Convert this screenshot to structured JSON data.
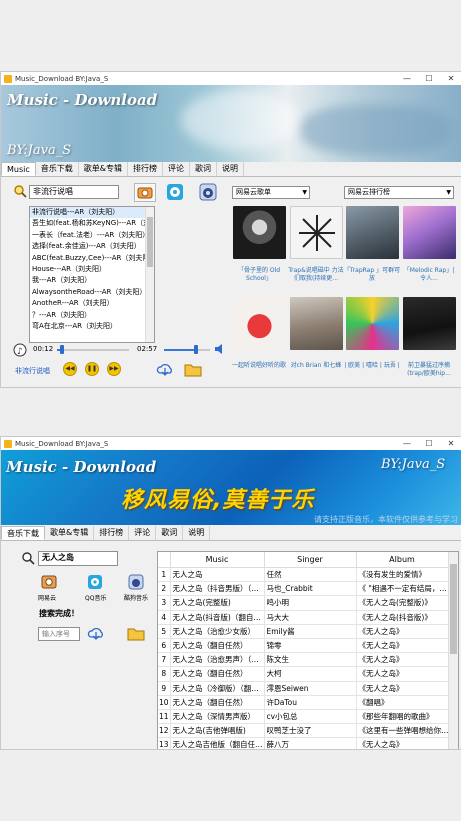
{
  "window1": {
    "title": "Music_Download  BY:Java_S",
    "banner": {
      "brand": "Music - Download",
      "byline": "BY:Java_S"
    },
    "tabs": [
      "Music",
      "音乐下载",
      "歌单&专辑",
      "排行榜",
      "评论",
      "歌词",
      "说明"
    ],
    "search_value": "非流行说唱",
    "song_list": [
      "非流行说唱---AR（刘夫阳）",
      "吾生如(feat.杨和苏KeyNG)---AR（刘",
      "一表长（feat.法老）---AR（刘夫阳）",
      "选择(feat.余佳运)---AR（刘夫阳）",
      "ABC(feat.Buzzy,Cee)---AR（刘夫阳",
      "House---AR（刘夫阳）",
      "我---AR（刘夫阳）",
      "AlwaysontheRoad---AR（刘夫阳）",
      "AnotheR---AR（刘夫阳）",
      "？---AR（刘夫阳）",
      "弯A在北京---AR（刘夫阳）"
    ],
    "time_elapsed": "00:12",
    "time_total": "02:57",
    "progress": 0.07,
    "volume": 0.7,
    "now_playing": "非流行说唱",
    "playlist_combo": "网易云歌单",
    "ranking_combo": "网易云排行榜",
    "covers_row1": [
      "「骨子里的 Old School」",
      "Trap&说唱磁中 力法们取我(持续更...",
      "「TrapRap 」可群可放",
      "「Melodic Rap」| 令人..."
    ],
    "covers_row2": [
      "一起听说唱好听的歌",
      "对ch Brian 和七蜂",
      "| 欧美 | 嘻哈 | 玩吾 |",
      "前卫暴猛过序摘(trap/欧美hip..."
    ]
  },
  "window2": {
    "title": "Music_Download  BY:Java_S",
    "banner": {
      "brand": "Music - Download",
      "byline": "BY:Java_S",
      "slogan": "移风易俗,莫善于乐",
      "notice": "请支持正版音乐，本软件仅供参考与学习"
    },
    "tabs": [
      "音乐下载",
      "歌单&专辑",
      "排行榜",
      "评论",
      "歌词",
      "说明"
    ],
    "search_value": "无人之岛",
    "sources": [
      "网易云",
      "QQ音乐",
      "酷狗音乐"
    ],
    "status": "搜索完成！",
    "index_placeholder": "输入序号",
    "columns": [
      "Music",
      "Singer",
      "Album"
    ],
    "rows": [
      {
        "n": "1",
        "music": "无人之岛",
        "singer": "任然",
        "album": "《没有发生的爱情》"
      },
      {
        "n": "2",
        "music": "无人之岛（抖音男版）（…",
        "singer": "马也_Crabbit",
        "album": "《 \"相遇不一定有结局，…"
      },
      {
        "n": "3",
        "music": "无人之岛(完整版)",
        "singer": "鸣小明",
        "album": "《无人之岛(完整版)》"
      },
      {
        "n": "4",
        "music": "无人之岛(抖音版)（翻自…",
        "singer": "马大大",
        "album": "《无人之岛(抖音版)》"
      },
      {
        "n": "5",
        "music": "无人之岛（治愈少女版）",
        "singer": "Emily酱",
        "album": "《无人之岛》"
      },
      {
        "n": "6",
        "music": "无人之岛（翻自任然）",
        "singer": "锦零",
        "album": "《无人之岛》"
      },
      {
        "n": "7",
        "music": "无人之岛（治愈男声）（…",
        "singer": "陈文生",
        "album": "《无人之岛》"
      },
      {
        "n": "8",
        "music": "无人之岛（翻自任然）",
        "singer": "大柯",
        "album": "《无人之岛》"
      },
      {
        "n": "9",
        "music": "无人之岛（冷御版）（翻…",
        "singer": "澪恩Seiwen",
        "album": "《无人之岛》"
      },
      {
        "n": "10",
        "music": "无人之岛（翻自任然）",
        "singer": "许DaTou",
        "album": "《翻唱》"
      },
      {
        "n": "11",
        "music": "无人之岛（深情男声版）",
        "singer": "cv小包总",
        "album": "《那些年翻唱的歌曲》"
      },
      {
        "n": "12",
        "music": "无人之岛(吉他弹唱版)",
        "singer": "叹鸭芝士没了",
        "album": "《这里有一些弹唱想给你…"
      },
      {
        "n": "13",
        "music": "无人之岛吉他版（翻自任…",
        "singer": "薛八万",
        "album": "《无人之岛》"
      }
    ]
  }
}
